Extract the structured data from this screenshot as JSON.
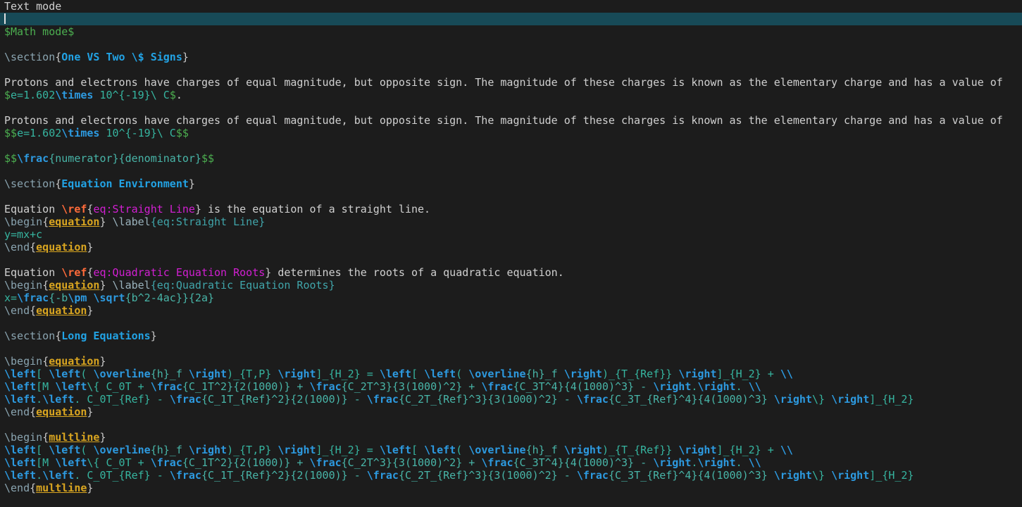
{
  "editor": {
    "lines": [
      {
        "segments": [
          {
            "t": "Text mode",
            "c": "text"
          }
        ]
      },
      {
        "cursorline": true,
        "cursor": true,
        "segments": []
      },
      {
        "segments": [
          {
            "t": "$Math mode$",
            "c": "math"
          }
        ]
      },
      {
        "segments": []
      },
      {
        "segments": [
          {
            "t": "\\section",
            "c": "cmd"
          },
          {
            "t": "{",
            "c": "brace"
          },
          {
            "t": "One VS Two \\$ Signs",
            "c": "sect"
          },
          {
            "t": "}",
            "c": "brace"
          }
        ]
      },
      {
        "segments": []
      },
      {
        "segments": [
          {
            "t": "Protons and electrons have charges of equal magnitude, but opposite sign. The magnitude of these charges is known as the elementary charge and has a value of",
            "c": "text"
          }
        ]
      },
      {
        "segments": [
          {
            "t": "$",
            "c": "math"
          },
          {
            "t": "e=1.602",
            "c": "mbody"
          },
          {
            "t": "\\times",
            "c": "mcmd"
          },
          {
            "t": " 10^{-19}\\ C",
            "c": "mbody"
          },
          {
            "t": "$",
            "c": "math"
          },
          {
            "t": ".",
            "c": "text"
          }
        ]
      },
      {
        "segments": []
      },
      {
        "segments": [
          {
            "t": "Protons and electrons have charges of equal magnitude, but opposite sign. The magnitude of these charges is known as the elementary charge and has a value of",
            "c": "text"
          }
        ]
      },
      {
        "segments": [
          {
            "t": "$$",
            "c": "math"
          },
          {
            "t": "e=1.602",
            "c": "mbody"
          },
          {
            "t": "\\times",
            "c": "mcmd"
          },
          {
            "t": " 10^{-19}\\ C",
            "c": "mbody"
          },
          {
            "t": "$$",
            "c": "math"
          }
        ]
      },
      {
        "segments": []
      },
      {
        "segments": [
          {
            "t": "$$",
            "c": "math"
          },
          {
            "t": "\\frac",
            "c": "mcmd"
          },
          {
            "t": "{numerator}{denominator}",
            "c": "marg"
          },
          {
            "t": "$$",
            "c": "math"
          }
        ]
      },
      {
        "segments": []
      },
      {
        "segments": [
          {
            "t": "\\section",
            "c": "cmd"
          },
          {
            "t": "{",
            "c": "brace"
          },
          {
            "t": "Equation Environment",
            "c": "sect"
          },
          {
            "t": "}",
            "c": "brace"
          }
        ]
      },
      {
        "segments": []
      },
      {
        "segments": [
          {
            "t": "Equation ",
            "c": "text"
          },
          {
            "t": "\\ref",
            "c": "ref"
          },
          {
            "t": "{",
            "c": "brace"
          },
          {
            "t": "eq:Straight Line",
            "c": "label"
          },
          {
            "t": "}",
            "c": "brace"
          },
          {
            "t": " is the equation of a straight line.",
            "c": "text"
          }
        ]
      },
      {
        "segments": [
          {
            "t": "\\begin",
            "c": "cmd"
          },
          {
            "t": "{",
            "c": "brace"
          },
          {
            "t": "equation",
            "c": "env"
          },
          {
            "t": "}",
            "c": "brace"
          },
          {
            "t": " ",
            "c": "text"
          },
          {
            "t": "\\label",
            "c": "lcmd"
          },
          {
            "t": "{eq:Straight Line}",
            "c": "larg"
          }
        ]
      },
      {
        "segments": [
          {
            "t": "y=mx+c",
            "c": "mbody"
          }
        ]
      },
      {
        "segments": [
          {
            "t": "\\end",
            "c": "cmd"
          },
          {
            "t": "{",
            "c": "brace"
          },
          {
            "t": "equation",
            "c": "env"
          },
          {
            "t": "}",
            "c": "brace"
          }
        ]
      },
      {
        "segments": []
      },
      {
        "segments": [
          {
            "t": "Equation ",
            "c": "text"
          },
          {
            "t": "\\ref",
            "c": "ref"
          },
          {
            "t": "{",
            "c": "brace"
          },
          {
            "t": "eq:Quadratic Equation Roots",
            "c": "label"
          },
          {
            "t": "}",
            "c": "brace"
          },
          {
            "t": " determines the roots of a quadratic equation.",
            "c": "text"
          }
        ]
      },
      {
        "segments": [
          {
            "t": "\\begin",
            "c": "cmd"
          },
          {
            "t": "{",
            "c": "brace"
          },
          {
            "t": "equation",
            "c": "env"
          },
          {
            "t": "}",
            "c": "brace"
          },
          {
            "t": " ",
            "c": "text"
          },
          {
            "t": "\\label",
            "c": "lcmd"
          },
          {
            "t": "{eq:Quadratic Equation Roots}",
            "c": "larg"
          }
        ]
      },
      {
        "segments": [
          {
            "t": "x=",
            "c": "mbody"
          },
          {
            "t": "\\frac",
            "c": "mcmd"
          },
          {
            "t": "{-b",
            "c": "marg"
          },
          {
            "t": "\\pm",
            "c": "mcmd"
          },
          {
            "t": " ",
            "c": "mbody"
          },
          {
            "t": "\\sqrt",
            "c": "mcmd"
          },
          {
            "t": "{b^2-4ac}}{2a}",
            "c": "marg"
          }
        ]
      },
      {
        "segments": [
          {
            "t": "\\end",
            "c": "cmd"
          },
          {
            "t": "{",
            "c": "brace"
          },
          {
            "t": "equation",
            "c": "env"
          },
          {
            "t": "}",
            "c": "brace"
          }
        ]
      },
      {
        "segments": []
      },
      {
        "segments": [
          {
            "t": "\\section",
            "c": "cmd"
          },
          {
            "t": "{",
            "c": "brace"
          },
          {
            "t": "Long Equations",
            "c": "sect"
          },
          {
            "t": "}",
            "c": "brace"
          }
        ]
      },
      {
        "segments": []
      },
      {
        "segments": [
          {
            "t": "\\begin",
            "c": "cmd"
          },
          {
            "t": "{",
            "c": "brace"
          },
          {
            "t": "equation",
            "c": "env"
          },
          {
            "t": "}",
            "c": "brace"
          }
        ]
      },
      {
        "segments": [
          {
            "t": "\\left",
            "c": "mcmd"
          },
          {
            "t": "[ ",
            "c": "mbody"
          },
          {
            "t": "\\left",
            "c": "mcmd"
          },
          {
            "t": "( ",
            "c": "mbody"
          },
          {
            "t": "\\overline",
            "c": "mcmd"
          },
          {
            "t": "{h}_f ",
            "c": "marg"
          },
          {
            "t": "\\right",
            "c": "mcmd"
          },
          {
            "t": ")_{T,P} ",
            "c": "mbody"
          },
          {
            "t": "\\right",
            "c": "mcmd"
          },
          {
            "t": "]_{H_2} = ",
            "c": "mbody"
          },
          {
            "t": "\\left",
            "c": "mcmd"
          },
          {
            "t": "[ ",
            "c": "mbody"
          },
          {
            "t": "\\left",
            "c": "mcmd"
          },
          {
            "t": "( ",
            "c": "mbody"
          },
          {
            "t": "\\overline",
            "c": "mcmd"
          },
          {
            "t": "{h}_f ",
            "c": "marg"
          },
          {
            "t": "\\right",
            "c": "mcmd"
          },
          {
            "t": ")_{T_{Ref}} ",
            "c": "mbody"
          },
          {
            "t": "\\right",
            "c": "mcmd"
          },
          {
            "t": "]_{H_2} + ",
            "c": "mbody"
          },
          {
            "t": "\\\\",
            "c": "mcmd"
          }
        ]
      },
      {
        "segments": [
          {
            "t": "\\left",
            "c": "mcmd"
          },
          {
            "t": "[M ",
            "c": "mbody"
          },
          {
            "t": "\\left",
            "c": "mcmd"
          },
          {
            "t": "\\{ C_0T + ",
            "c": "mbody"
          },
          {
            "t": "\\frac",
            "c": "mcmd"
          },
          {
            "t": "{C_1T^2}{2(1000)} + ",
            "c": "marg"
          },
          {
            "t": "\\frac",
            "c": "mcmd"
          },
          {
            "t": "{C_2T^3}{3(1000)^2} + ",
            "c": "marg"
          },
          {
            "t": "\\frac",
            "c": "mcmd"
          },
          {
            "t": "{C_3T^4}{4(1000)^3} - ",
            "c": "marg"
          },
          {
            "t": "\\right",
            "c": "mcmd"
          },
          {
            "t": ".",
            "c": "mbody"
          },
          {
            "t": "\\right",
            "c": "mcmd"
          },
          {
            "t": ". ",
            "c": "mbody"
          },
          {
            "t": "\\\\",
            "c": "mcmd"
          }
        ]
      },
      {
        "segments": [
          {
            "t": "\\left",
            "c": "mcmd"
          },
          {
            "t": ".",
            "c": "mbody"
          },
          {
            "t": "\\left",
            "c": "mcmd"
          },
          {
            "t": ". C_0T_{Ref} - ",
            "c": "mbody"
          },
          {
            "t": "\\frac",
            "c": "mcmd"
          },
          {
            "t": "{C_1T_{Ref}^2}{2(1000)} - ",
            "c": "marg"
          },
          {
            "t": "\\frac",
            "c": "mcmd"
          },
          {
            "t": "{C_2T_{Ref}^3}{3(1000)^2} - ",
            "c": "marg"
          },
          {
            "t": "\\frac",
            "c": "mcmd"
          },
          {
            "t": "{C_3T_{Ref}^4}{4(1000)^3} ",
            "c": "marg"
          },
          {
            "t": "\\right",
            "c": "mcmd"
          },
          {
            "t": "\\} ",
            "c": "mbody"
          },
          {
            "t": "\\right",
            "c": "mcmd"
          },
          {
            "t": "]_{H_2}",
            "c": "mbody"
          }
        ]
      },
      {
        "segments": [
          {
            "t": "\\end",
            "c": "cmd"
          },
          {
            "t": "{",
            "c": "brace"
          },
          {
            "t": "equation",
            "c": "env"
          },
          {
            "t": "}",
            "c": "brace"
          }
        ]
      },
      {
        "segments": []
      },
      {
        "segments": [
          {
            "t": "\\begin",
            "c": "cmd"
          },
          {
            "t": "{",
            "c": "brace"
          },
          {
            "t": "multline",
            "c": "env"
          },
          {
            "t": "}",
            "c": "brace"
          }
        ]
      },
      {
        "segments": [
          {
            "t": "\\left",
            "c": "mcmd"
          },
          {
            "t": "[ ",
            "c": "mbody"
          },
          {
            "t": "\\left",
            "c": "mcmd"
          },
          {
            "t": "( ",
            "c": "mbody"
          },
          {
            "t": "\\overline",
            "c": "mcmd"
          },
          {
            "t": "{h}_f ",
            "c": "marg"
          },
          {
            "t": "\\right",
            "c": "mcmd"
          },
          {
            "t": ")_{T,P} ",
            "c": "mbody"
          },
          {
            "t": "\\right",
            "c": "mcmd"
          },
          {
            "t": "]_{H_2} = ",
            "c": "mbody"
          },
          {
            "t": "\\left",
            "c": "mcmd"
          },
          {
            "t": "[ ",
            "c": "mbody"
          },
          {
            "t": "\\left",
            "c": "mcmd"
          },
          {
            "t": "( ",
            "c": "mbody"
          },
          {
            "t": "\\overline",
            "c": "mcmd"
          },
          {
            "t": "{h}_f ",
            "c": "marg"
          },
          {
            "t": "\\right",
            "c": "mcmd"
          },
          {
            "t": ")_{T_{Ref}} ",
            "c": "mbody"
          },
          {
            "t": "\\right",
            "c": "mcmd"
          },
          {
            "t": "]_{H_2} + ",
            "c": "mbody"
          },
          {
            "t": "\\\\",
            "c": "mcmd"
          }
        ]
      },
      {
        "segments": [
          {
            "t": "\\left",
            "c": "mcmd"
          },
          {
            "t": "[M ",
            "c": "mbody"
          },
          {
            "t": "\\left",
            "c": "mcmd"
          },
          {
            "t": "\\{ C_0T + ",
            "c": "mbody"
          },
          {
            "t": "\\frac",
            "c": "mcmd"
          },
          {
            "t": "{C_1T^2}{2(1000)} + ",
            "c": "marg"
          },
          {
            "t": "\\frac",
            "c": "mcmd"
          },
          {
            "t": "{C_2T^3}{3(1000)^2} + ",
            "c": "marg"
          },
          {
            "t": "\\frac",
            "c": "mcmd"
          },
          {
            "t": "{C_3T^4}{4(1000)^3} - ",
            "c": "marg"
          },
          {
            "t": "\\right",
            "c": "mcmd"
          },
          {
            "t": ".",
            "c": "mbody"
          },
          {
            "t": "\\right",
            "c": "mcmd"
          },
          {
            "t": ". ",
            "c": "mbody"
          },
          {
            "t": "\\\\",
            "c": "mcmd"
          }
        ]
      },
      {
        "segments": [
          {
            "t": "\\left",
            "c": "mcmd"
          },
          {
            "t": ".",
            "c": "mbody"
          },
          {
            "t": "\\left",
            "c": "mcmd"
          },
          {
            "t": ". C_0T_{Ref} - ",
            "c": "mbody"
          },
          {
            "t": "\\frac",
            "c": "mcmd"
          },
          {
            "t": "{C_1T_{Ref}^2}{2(1000)} - ",
            "c": "marg"
          },
          {
            "t": "\\frac",
            "c": "mcmd"
          },
          {
            "t": "{C_2T_{Ref}^3}{3(1000)^2} - ",
            "c": "marg"
          },
          {
            "t": "\\frac",
            "c": "mcmd"
          },
          {
            "t": "{C_3T_{Ref}^4}{4(1000)^3} ",
            "c": "marg"
          },
          {
            "t": "\\right",
            "c": "mcmd"
          },
          {
            "t": "\\} ",
            "c": "mbody"
          },
          {
            "t": "\\right",
            "c": "mcmd"
          },
          {
            "t": "]_{H_2}",
            "c": "mbody"
          }
        ]
      },
      {
        "segments": [
          {
            "t": "\\end",
            "c": "cmd"
          },
          {
            "t": "{",
            "c": "brace"
          },
          {
            "t": "multline",
            "c": "env"
          },
          {
            "t": "}",
            "c": "brace"
          }
        ]
      }
    ]
  }
}
